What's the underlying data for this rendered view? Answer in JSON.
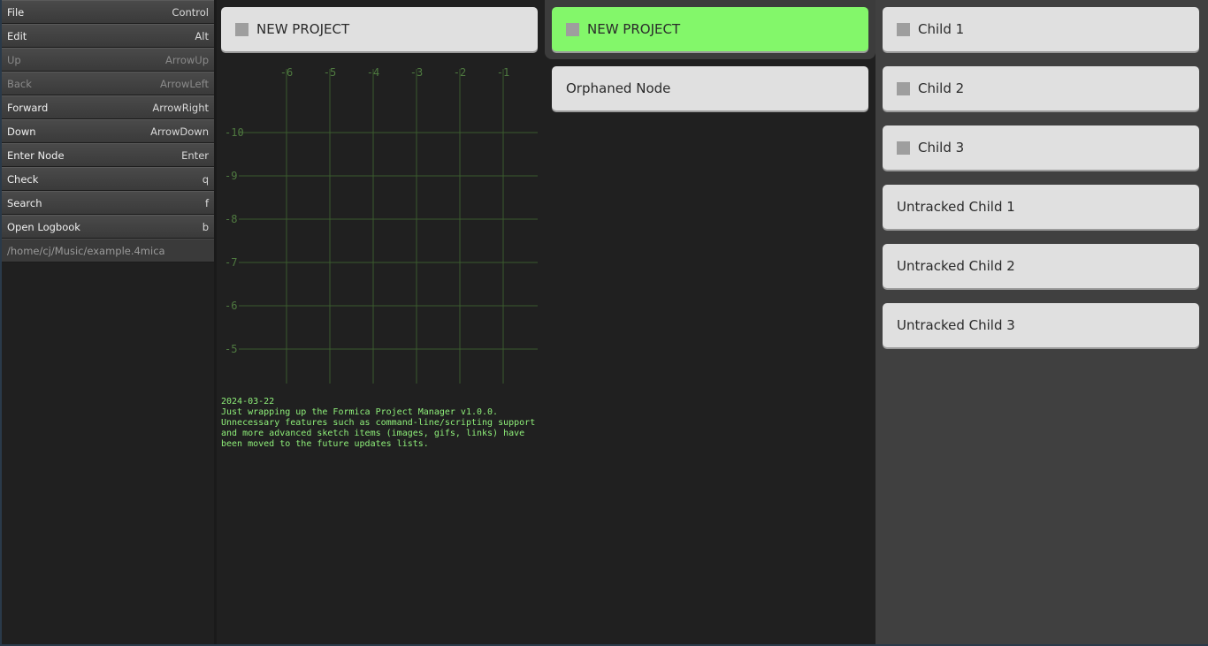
{
  "menu": [
    {
      "label": "File",
      "shortcut": "Control",
      "enabled": true
    },
    {
      "label": "Edit",
      "shortcut": "Alt",
      "enabled": true
    },
    {
      "label": "Up",
      "shortcut": "ArrowUp",
      "enabled": false
    },
    {
      "label": "Back",
      "shortcut": "ArrowLeft",
      "enabled": false
    },
    {
      "label": "Forward",
      "shortcut": "ArrowRight",
      "enabled": true
    },
    {
      "label": "Down",
      "shortcut": "ArrowDown",
      "enabled": true
    },
    {
      "label": "Enter Node",
      "shortcut": "Enter",
      "enabled": true
    },
    {
      "label": "Check",
      "shortcut": "q",
      "enabled": true
    },
    {
      "label": "Search",
      "shortcut": "f",
      "enabled": true
    },
    {
      "label": "Open Logbook",
      "shortcut": "b",
      "enabled": true
    }
  ],
  "file_path": "/home/cj/Music/example.4mica",
  "parent_column": {
    "node": {
      "label": "NEW PROJECT",
      "has_checkbox": true
    }
  },
  "current_column": {
    "nodes": [
      {
        "label": "NEW PROJECT",
        "has_checkbox": true,
        "selected": true
      },
      {
        "label": "Orphaned Node",
        "has_checkbox": false,
        "selected": false
      }
    ]
  },
  "children_column": {
    "nodes": [
      {
        "label": "Child 1",
        "has_checkbox": true
      },
      {
        "label": "Child 2",
        "has_checkbox": true
      },
      {
        "label": "Child 3",
        "has_checkbox": true
      },
      {
        "label": "Untracked Child 1",
        "has_checkbox": false
      },
      {
        "label": "Untracked Child 2",
        "has_checkbox": false
      },
      {
        "label": "Untracked Child 3",
        "has_checkbox": false
      }
    ]
  },
  "sketch_grid": {
    "x_labels": [
      "-6",
      "-5",
      "-4",
      "-3",
      "-2",
      "-1"
    ],
    "y_labels": [
      "-10",
      "-9",
      "-8",
      "-7",
      "-6",
      "-5"
    ],
    "line_color": "#3a5a2e",
    "label_color": "#4f7a40"
  },
  "log": {
    "date": "2024-03-22",
    "text": "Just wrapping up the Formica Project Manager v1.0.0.\nUnnecessary features such as command-line/scripting support\nand more advanced sketch items (images, gifs, links) have\nbeen moved to the future updates lists."
  },
  "colors": {
    "selected_node": "#83f76a",
    "node": "#e0e0e0",
    "log_text": "#8ff07a"
  }
}
